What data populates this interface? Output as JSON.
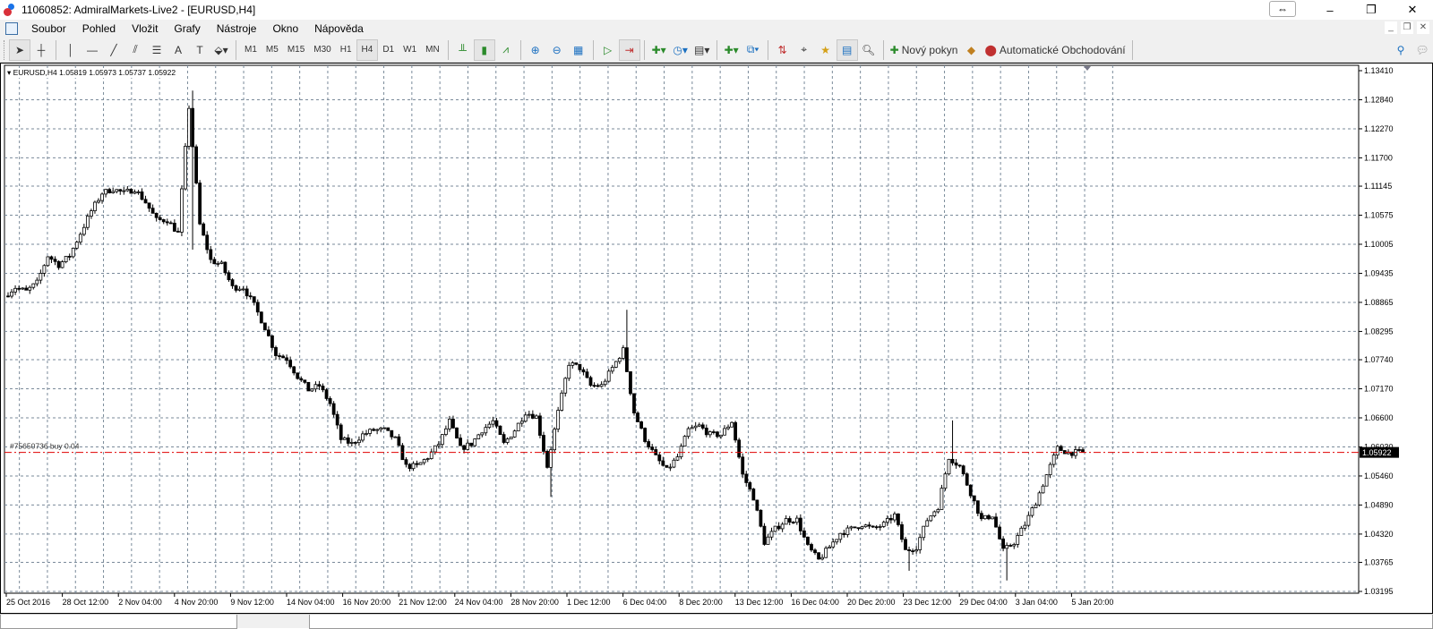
{
  "window": {
    "title": "11060852: AdmiralMarkets-Live2 - [EURUSD,H4]",
    "controls": [
      "–",
      "❐",
      "✕"
    ]
  },
  "menu": {
    "items": [
      "Soubor",
      "Pohled",
      "Vložit",
      "Grafy",
      "Nástroje",
      "Okno",
      "Nápověda"
    ]
  },
  "toolbar": {
    "timeframes": [
      "M1",
      "M5",
      "M15",
      "M30",
      "H1",
      "H4",
      "D1",
      "W1",
      "MN"
    ],
    "active_timeframe": "H4",
    "new_order_label": "Nový pokyn",
    "auto_trading_label": "Automatické Obchodování"
  },
  "chart_data": {
    "type": "candlestick",
    "symbol_info": "EURUSD,H4  1.05819 1.05973 1.05737 1.05922",
    "order_line_label": "#75650736 buy 0.04",
    "order_price": 1.05922,
    "current_price_label": "1.05922",
    "ylim": [
      1.03195,
      1.1341
    ],
    "y_ticks": [
      "1.13410",
      "1.12840",
      "1.12270",
      "1.11700",
      "1.11145",
      "1.10575",
      "1.10005",
      "1.09435",
      "1.08865",
      "1.08295",
      "1.07740",
      "1.07170",
      "1.06600",
      "1.06030",
      "1.05460",
      "1.04890",
      "1.04320",
      "1.03765",
      "1.03195"
    ],
    "x_ticks": [
      "25 Oct 2016",
      "28 Oct 12:00",
      "2 Nov 04:00",
      "4 Nov 20:00",
      "9 Nov 12:00",
      "14 Nov 04:00",
      "16 Nov 20:00",
      "21 Nov 12:00",
      "24 Nov 04:00",
      "28 Nov 20:00",
      "1 Dec 12:00",
      "6 Dec 04:00",
      "8 Dec 20:00",
      "13 Dec 12:00",
      "16 Dec 04:00",
      "20 Dec 20:00",
      "23 Dec 12:00",
      "29 Dec 04:00",
      "3 Jan 04:00",
      "5 Jan 20:00"
    ],
    "grid": true,
    "closes": [
      1.0899,
      1.0916,
      1.0908,
      1.0925,
      1.0978,
      1.096,
      1.0978,
      1.1022,
      1.1066,
      1.1101,
      1.1109,
      1.1101,
      1.1109,
      1.1083,
      1.1048,
      1.1048,
      1.1022,
      1.127,
      1.1039,
      1.0969,
      1.096,
      1.0916,
      1.0916,
      1.0881,
      1.0837,
      1.0785,
      1.0776,
      1.0741,
      1.0715,
      1.0723,
      1.0688,
      1.0618,
      1.0609,
      1.0627,
      1.0636,
      1.0636,
      1.0618,
      1.0565,
      1.0565,
      1.0583,
      1.0609,
      1.0653,
      1.06,
      1.0609,
      1.0636,
      1.0653,
      1.0609,
      1.0636,
      1.0671,
      1.0662,
      1.0565,
      1.0671,
      1.0767,
      1.0758,
      1.0723,
      1.0723,
      1.0758,
      1.0793,
      1.0671,
      1.0618,
      1.0583,
      1.0557,
      1.0583,
      1.0636,
      1.0644,
      1.0627,
      1.0627,
      1.0653,
      1.0548,
      1.0504,
      1.0416,
      1.0442,
      1.046,
      1.046,
      1.0407,
      1.0381,
      1.0407,
      1.0434,
      1.0442,
      1.0451,
      1.0442,
      1.0451,
      1.0469,
      1.0399,
      1.0407,
      1.046,
      1.0486,
      1.0583,
      1.0565,
      1.0513,
      1.046,
      1.0469,
      1.0399,
      1.0416,
      1.0451,
      1.0495,
      1.0548,
      1.06,
      1.0592,
      1.05922
    ],
    "extremes": [
      {
        "index": 17,
        "high": 1.1302,
        "low": 1.099
      },
      {
        "index": 57,
        "high": 1.0872
      },
      {
        "index": 50,
        "low": 1.0505
      },
      {
        "index": 87,
        "high": 1.0655
      },
      {
        "index": 92,
        "low": 1.0341
      },
      {
        "index": 83,
        "low": 1.036
      }
    ],
    "bull_color": "#000000",
    "bear_color": "#000000",
    "order_line_color": "#e00000",
    "grid_color": "#7a8a9a"
  }
}
